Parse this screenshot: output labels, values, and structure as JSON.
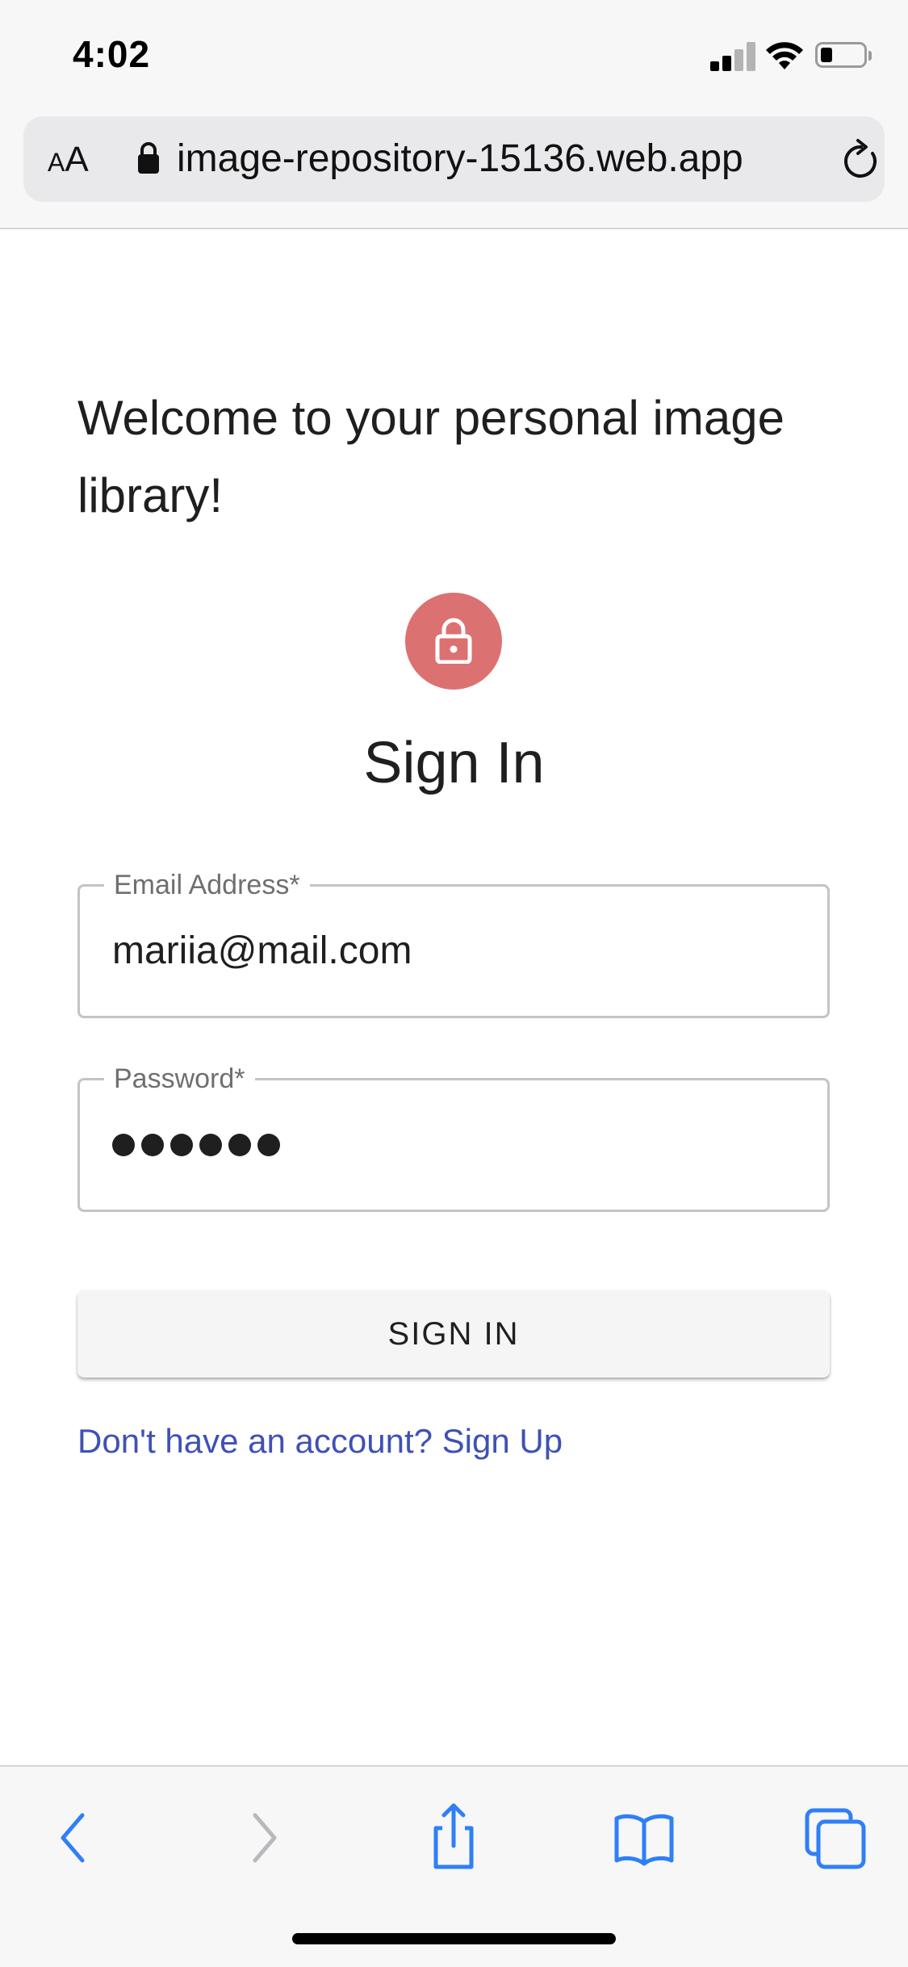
{
  "status_bar": {
    "time": "4:02"
  },
  "browser": {
    "text_size_small": "A",
    "text_size_large": "A",
    "url": "image-repository-15136.web.app"
  },
  "page": {
    "welcome_text": "Welcome to your personal image library!",
    "title": "Sign In",
    "email": {
      "label": "Email Address*",
      "value": "mariia@mail.com"
    },
    "password": {
      "label": "Password*",
      "masked_length": 6
    },
    "signin_button": "SIGN IN",
    "signup_link": "Don't have an account? Sign Up"
  },
  "colors": {
    "accent_avatar": "#dc7171",
    "link": "#3f51b5",
    "safari_blue": "#2f7ff7"
  },
  "toolbar": {
    "icons": [
      "back-icon",
      "forward-icon",
      "share-icon",
      "bookmarks-icon",
      "tabs-icon"
    ]
  }
}
